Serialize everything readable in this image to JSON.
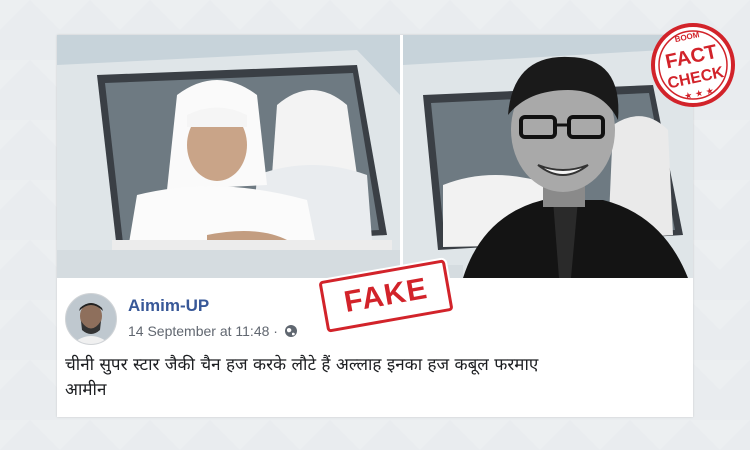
{
  "post": {
    "author": "Aimim-UP",
    "timestamp": "14 September at 11:48 ·",
    "text_line1": "चीनी सुपर स्टार जैकी चैन हज करके लौटे हैं अल्लाह इनका हज कबूल फरमाए",
    "text_line2": "आमीन"
  },
  "stamp": {
    "fake_label": "FAKE"
  },
  "badge": {
    "boom": "BOOM",
    "fact": "FACT",
    "check": "CHECK",
    "stars": "★ ★ ★"
  },
  "icons": {
    "audience": "globe-icon",
    "avatar": "profile-photo"
  },
  "colors": {
    "stamp_red": "#d2232a",
    "name_blue": "#385898"
  }
}
